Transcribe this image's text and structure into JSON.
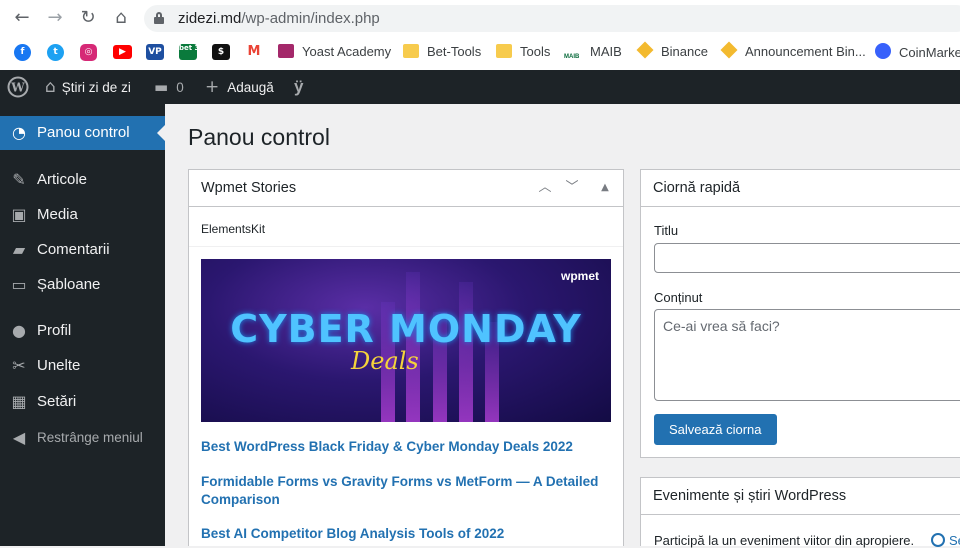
{
  "browser": {
    "url_domain": "zidezi.md",
    "url_path": "/wp-admin/index.php",
    "bookmarks": [
      {
        "label": "Yoast Academy"
      },
      {
        "label": "Bet-Tools"
      },
      {
        "label": "Tools"
      },
      {
        "label": "MAIB"
      },
      {
        "label": "Binance"
      },
      {
        "label": "Announcement Bin..."
      },
      {
        "label": "CoinMarke"
      }
    ],
    "icon_labels": {
      "vp": "VP",
      "bet365": "bet 365",
      "maib": "MAIB"
    }
  },
  "adminbar": {
    "site_name": "Știri zi de zi",
    "comments_count": "0",
    "add_new": "Adaugă"
  },
  "sidebar": {
    "items": [
      {
        "label": "Panou control",
        "icon": "dashboard-icon"
      },
      {
        "label": "Articole",
        "icon": "pin-icon"
      },
      {
        "label": "Media",
        "icon": "media-icon"
      },
      {
        "label": "Comentarii",
        "icon": "comment-icon"
      },
      {
        "label": "Șabloane",
        "icon": "folder-icon"
      },
      {
        "label": "Profil",
        "icon": "user-icon"
      },
      {
        "label": "Unelte",
        "icon": "wrench-icon"
      },
      {
        "label": "Setări",
        "icon": "settings-icon"
      }
    ],
    "collapse_label": "Restrânge meniul"
  },
  "main": {
    "page_title": "Panou control",
    "wpmet": {
      "title": "Wpmet Stories",
      "tab": "ElementsKit",
      "banner_logo": "wpmet",
      "banner_title": "CYBER MONDAY",
      "banner_script": "Deals",
      "links": [
        "Best WordPress Black Friday & Cyber Monday Deals 2022",
        "Formidable Forms vs Gravity Forms vs MetForm — A Detailed Comparison",
        "Best AI Competitor Blog Analysis Tools of 2022"
      ]
    },
    "quick_draft": {
      "title": "Ciornă rapidă",
      "title_label": "Titlu",
      "content_label": "Conținut",
      "content_placeholder": "Ce-ai vrea să faci?",
      "save_label": "Salvează ciorna"
    },
    "events": {
      "title": "Evenimente și știri WordPress",
      "text": "Participă la un eveniment viitor din apropiere.",
      "select_label": "Se"
    }
  },
  "colors": {
    "admin_dark": "#1d2327",
    "accent": "#2271b1",
    "background": "#f0f0f1"
  }
}
